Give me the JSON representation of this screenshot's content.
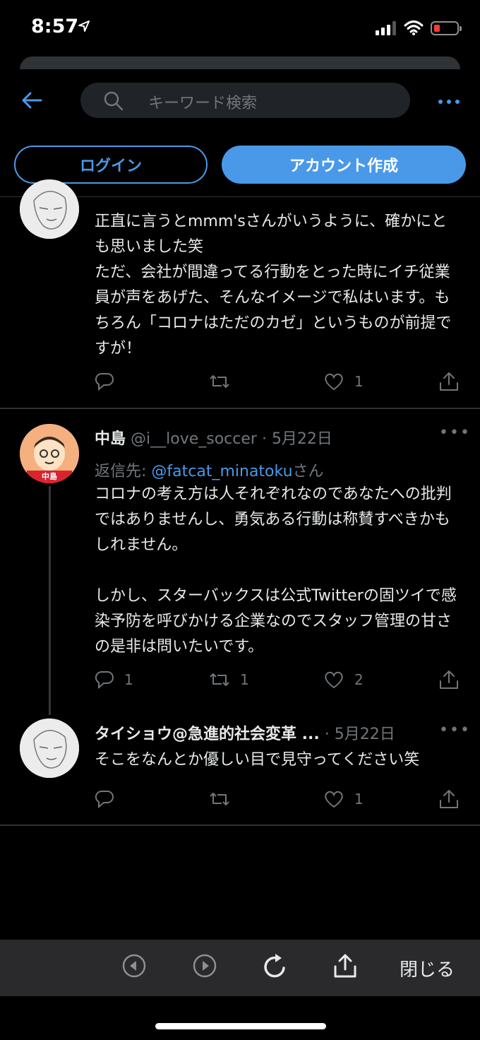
{
  "status_bar": {
    "time": "8:57"
  },
  "header": {
    "search_placeholder": "キーワード検索"
  },
  "auth": {
    "login_label": "ログイン",
    "create_label": "アカウント作成"
  },
  "tweets": [
    {
      "text": "正直に言うとmmm'sさんがいうように、確かにとも思いました笑\nただ、会社が間違ってる行動をとった時にイチ従業員が声をあげた、そんなイメージで私はいます。もちろん「コロナはただのカゼ」というものが前提ですが！",
      "reply_count": "",
      "retweet_count": "",
      "like_count": "1"
    },
    {
      "name": "中島",
      "handle": "@i__love_soccer",
      "date": "· 5月22日",
      "reply_prefix": "返信先: ",
      "reply_to": "@fatcat_minatoku",
      "reply_suffix": "さん",
      "avatar_label": "中島",
      "text": "コロナの考え方は人それぞれなのであなたへの批判ではありませんし、勇気ある行動は称賛すべきかもしれません。\n\nしかし、スターバックスは公式Twitterの固ツイで感染予防を呼びかける企業なのでスタッフ管理の甘さの是非は問いたいです。",
      "reply_count": "1",
      "retweet_count": "1",
      "like_count": "2"
    },
    {
      "name": "タイショウ@急進的社会変革 ...",
      "date": "· 5月22日",
      "text": "そこをなんとか優しい目で見守ってください笑",
      "reply_count": "",
      "retweet_count": "",
      "like_count": "1"
    }
  ],
  "browser_bar": {
    "close_label": "閉じる"
  },
  "colors": {
    "accent": "#4a99e9",
    "background": "#000000",
    "muted": "#71767b"
  }
}
